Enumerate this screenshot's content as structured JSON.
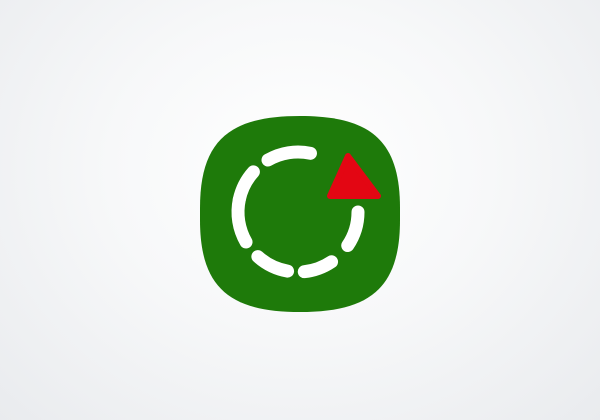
{
  "icon": {
    "name": "flashscore-app-icon",
    "description_glyphs": [
      "dashed-ring-icon",
      "warning-triangle-icon"
    ],
    "colors": {
      "background": "#1e7a0a",
      "ring": "#ffffff",
      "triangle": "#e30613",
      "page_background": "#f2f3f5"
    }
  }
}
